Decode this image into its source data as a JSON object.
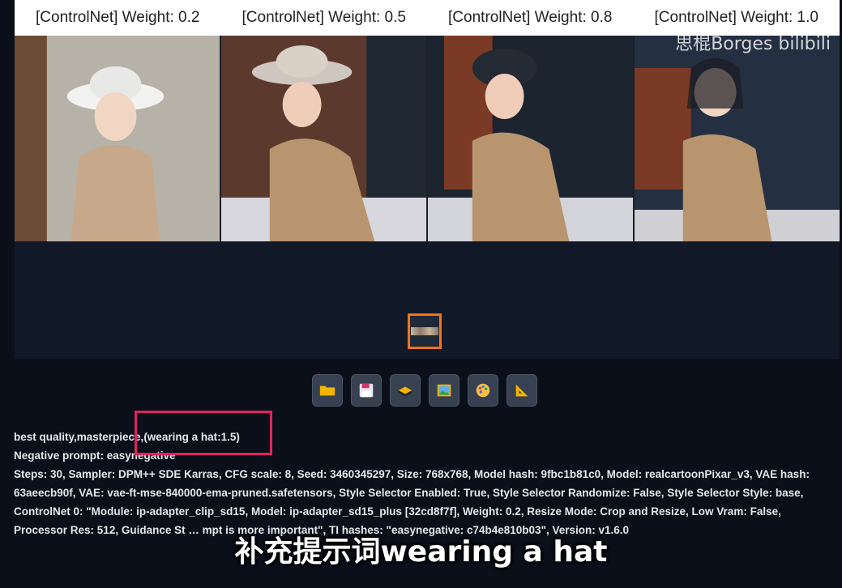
{
  "grid_headers": [
    "[ControlNet] Weight: 0.2",
    "[ControlNet] Weight: 0.5",
    "[ControlNet] Weight: 0.8",
    "[ControlNet] Weight: 1.0"
  ],
  "watermark": "思棍Borges bilibili",
  "toolbar": [
    {
      "name": "open-folder",
      "icon": "folder-icon"
    },
    {
      "name": "save",
      "icon": "floppy-disk-icon"
    },
    {
      "name": "zip",
      "icon": "archive-icon"
    },
    {
      "name": "send-to-img2img",
      "icon": "picture-icon"
    },
    {
      "name": "send-to-inpaint",
      "icon": "palette-icon"
    },
    {
      "name": "send-to-extras",
      "icon": "triangle-ruler-icon"
    }
  ],
  "infotext": {
    "prompt": "best quality,masterpiece,(wearing a hat:1.5)",
    "negative": "Negative prompt: easynegative",
    "params": "Steps: 30, Sampler: DPM++ SDE Karras, CFG scale: 8, Seed: 3460345297, Size: 768x768, Model hash: 9fbc1b81c0, Model: realcartoonPixar_v3, VAE hash: 63aeecb90f, VAE: vae-ft-mse-840000-ema-pruned.safetensors, Style Selector Enabled: True, Style Selector Randomize: False, Style Selector Style: base, ControlNet 0: \"Module: ip-adapter_clip_sd15, Model: ip-adapter_sd15_plus [32cd8f7f], Weight: 0.2, Resize Mode: Crop and Resize, Low Vram: False, Processor Res: 512, Guidance St",
    "params_tail": "mpt is more important\", TI hashes: \"easynegative: c74b4e810b03\", Version: v1.6.0"
  },
  "subtitle": "补充提示词wearing a hat",
  "colors": {
    "accent_orange": "#f97316",
    "highlight_pink": "#e0245e",
    "background": "#0b0f19"
  }
}
